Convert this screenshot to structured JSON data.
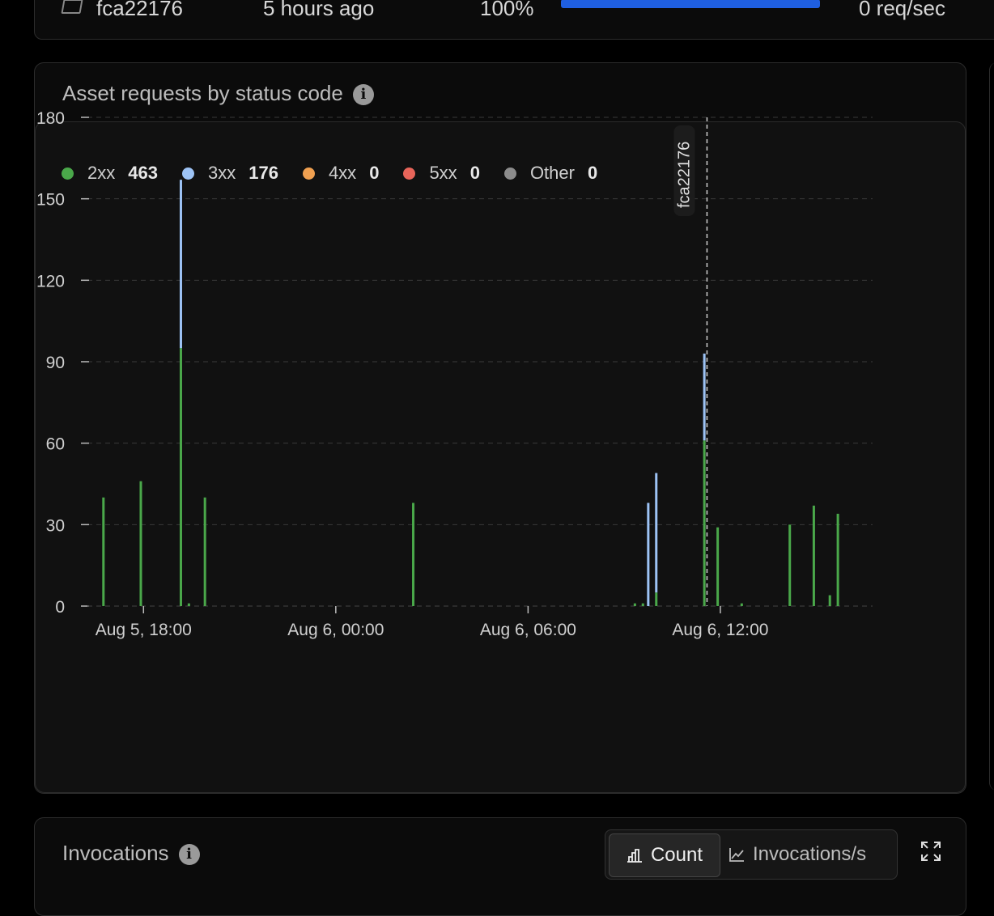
{
  "top_row": {
    "version": "fca22176",
    "time": "5 hours ago",
    "percent": "100%",
    "rate": "0 req/sec"
  },
  "card": {
    "title": "Asset requests by status code",
    "legend": [
      {
        "label": "2xx",
        "value": "463",
        "color": "#4aa84a"
      },
      {
        "label": "3xx",
        "value": "176",
        "color": "#9dc3f5"
      },
      {
        "label": "4xx",
        "value": "0",
        "color": "#f0a050"
      },
      {
        "label": "5xx",
        "value": "0",
        "color": "#e8655a"
      },
      {
        "label": "Other",
        "value": "0",
        "color": "#8c8c8c"
      }
    ]
  },
  "chart_data": {
    "type": "bar",
    "stacked": true,
    "title": "Asset requests by status code",
    "xlabel": "",
    "ylabel": "",
    "ylim": [
      0,
      180
    ],
    "yticks": [
      0,
      30,
      60,
      90,
      120,
      150,
      180
    ],
    "x_range_hours": [
      16.25,
      16.25
    ],
    "x_range": [
      "Aug 5, 16:15",
      "Aug 6, 16:45"
    ],
    "xticks": [
      {
        "label": "Aug 5, 18:00",
        "time": "Aug 5, 18:00"
      },
      {
        "label": "Aug 6, 00:00",
        "time": "Aug 6, 00:00"
      },
      {
        "label": "Aug 6, 06:00",
        "time": "Aug 6, 06:00"
      },
      {
        "label": "Aug 6, 12:00",
        "time": "Aug 6, 12:00"
      }
    ],
    "grid": true,
    "marker": {
      "label": "fca22176",
      "time": "Aug 6, 11:35"
    },
    "series": [
      {
        "name": "2xx",
        "color": "#4aa84a"
      },
      {
        "name": "3xx",
        "color": "#9dc3f5"
      }
    ],
    "bars": [
      {
        "time": "Aug 5, 16:45",
        "2xx": 40,
        "3xx": 0
      },
      {
        "time": "Aug 5, 17:55",
        "2xx": 46,
        "3xx": 0
      },
      {
        "time": "Aug 5, 19:10",
        "2xx": 95,
        "3xx": 62
      },
      {
        "time": "Aug 5, 19:25",
        "2xx": 1,
        "3xx": 0
      },
      {
        "time": "Aug 5, 19:55",
        "2xx": 40,
        "3xx": 0
      },
      {
        "time": "Aug 6, 02:25",
        "2xx": 38,
        "3xx": 0
      },
      {
        "time": "Aug 6, 09:20",
        "2xx": 1,
        "3xx": 0
      },
      {
        "time": "Aug 6, 09:35",
        "2xx": 1,
        "3xx": 0
      },
      {
        "time": "Aug 6, 09:45",
        "2xx": 0,
        "3xx": 38
      },
      {
        "time": "Aug 6, 10:00",
        "2xx": 5,
        "3xx": 44
      },
      {
        "time": "Aug 6, 11:30",
        "2xx": 61,
        "3xx": 32
      },
      {
        "time": "Aug 6, 11:55",
        "2xx": 29,
        "3xx": 0
      },
      {
        "time": "Aug 6, 12:40",
        "2xx": 1,
        "3xx": 0
      },
      {
        "time": "Aug 6, 14:10",
        "2xx": 30,
        "3xx": 0
      },
      {
        "time": "Aug 6, 14:55",
        "2xx": 37,
        "3xx": 0
      },
      {
        "time": "Aug 6, 15:25",
        "2xx": 4,
        "3xx": 0
      },
      {
        "time": "Aug 6, 15:40",
        "2xx": 34,
        "3xx": 0
      }
    ]
  },
  "card2": {
    "title": "Invocations",
    "toggle_count": "Count",
    "toggle_rate": "Invocations/s"
  }
}
